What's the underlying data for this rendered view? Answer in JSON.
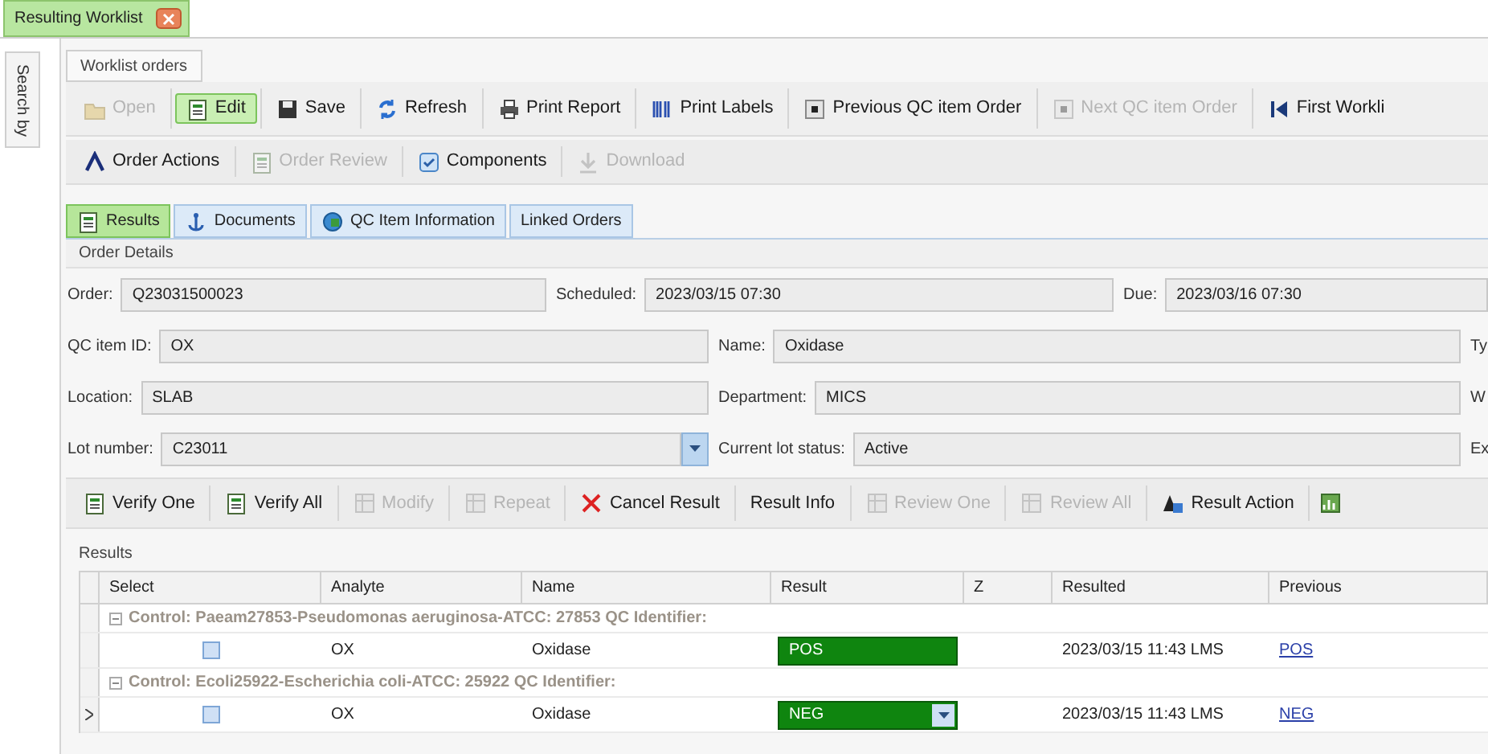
{
  "document_tab": {
    "title": "Resulting Worklist",
    "selected": true
  },
  "side_tab": {
    "label": "Search by"
  },
  "panel_tab": {
    "label": "Worklist orders"
  },
  "toolbar": [
    {
      "label": "Open",
      "disabled": true,
      "selected": false
    },
    {
      "label": "Edit",
      "disabled": false,
      "selected": true
    },
    {
      "label": "Save",
      "disabled": false,
      "selected": false
    },
    {
      "label": "Refresh",
      "disabled": false,
      "selected": false
    },
    {
      "label": "Print Report",
      "disabled": false,
      "selected": false
    },
    {
      "label": "Print Labels",
      "disabled": false,
      "selected": false
    },
    {
      "label": "Previous QC item Order",
      "disabled": false,
      "selected": false
    },
    {
      "label": "Next QC item Order",
      "disabled": true,
      "selected": false
    },
    {
      "label": "First Workli",
      "disabled": false,
      "selected": false
    }
  ],
  "order_toolbar": [
    {
      "label": "Order Actions",
      "disabled": false
    },
    {
      "label": "Order Review",
      "disabled": true
    },
    {
      "label": "Components",
      "disabled": false
    },
    {
      "label": "Download",
      "disabled": true
    }
  ],
  "tabs": [
    {
      "label": "Results",
      "selected": true
    },
    {
      "label": "Documents",
      "selected": false
    },
    {
      "label": "QC Item Information",
      "selected": false
    },
    {
      "label": "Linked Orders",
      "selected": false
    }
  ],
  "order_details": {
    "title": "Order Details",
    "rows": [
      [
        {
          "label": "Order:",
          "value": "Q23031500023"
        },
        {
          "label": "Scheduled:",
          "value": "2023/03/15 07:30"
        },
        {
          "label": "Due:",
          "value": "2023/03/16 07:30"
        }
      ],
      [
        {
          "label": "QC item ID:",
          "value": "OX"
        },
        {
          "label": "Name:",
          "value": "Oxidase"
        },
        {
          "label": "Ty"
        }
      ],
      [
        {
          "label": "Location:",
          "value": "SLAB"
        },
        {
          "label": "Department:",
          "value": "MICS"
        },
        {
          "label": "W"
        }
      ],
      [
        {
          "label": "Lot number:",
          "value": "C23011",
          "dropdown": true
        },
        {
          "label": "Current lot status:",
          "value": "Active"
        },
        {
          "label": "Ex"
        }
      ]
    ]
  },
  "result_toolbar": [
    {
      "label": "Verify One",
      "disabled": false
    },
    {
      "label": "Verify All",
      "disabled": false
    },
    {
      "label": "Modify",
      "disabled": true
    },
    {
      "label": "Repeat",
      "disabled": true
    },
    {
      "label": "Cancel Result",
      "disabled": false
    },
    {
      "label": "Result Info",
      "disabled": false
    },
    {
      "label": "Review One",
      "disabled": true
    },
    {
      "label": "Review All",
      "disabled": true
    },
    {
      "label": "Result Action",
      "disabled": false
    }
  ],
  "results": {
    "title": "Results",
    "columns": [
      "Select",
      "Analyte",
      "Name",
      "Result",
      "Z",
      "Resulted",
      "Previous"
    ],
    "rows": [
      {
        "kind": "group",
        "text": "Control: Paeam27853-Pseudomonas aeruginosa-ATCC: 27853 QC Identifier:",
        "expanded": true
      },
      {
        "kind": "result",
        "current": false,
        "checked": false,
        "analyte": "OX",
        "name": "Oxidase",
        "result": "POS",
        "dropdown": false,
        "resulted": "2023/03/15 11:43 LMS",
        "previous": "POS"
      },
      {
        "kind": "group",
        "text": "Control: Ecoli25922-Escherichia coli-ATCC: 25922 QC Identifier:",
        "expanded": true
      },
      {
        "kind": "result",
        "current": true,
        "checked": false,
        "analyte": "OX",
        "name": "Oxidase",
        "result": "NEG",
        "dropdown": true,
        "resulted": "2023/03/15 11:43 LMS",
        "previous": "NEG"
      }
    ]
  }
}
